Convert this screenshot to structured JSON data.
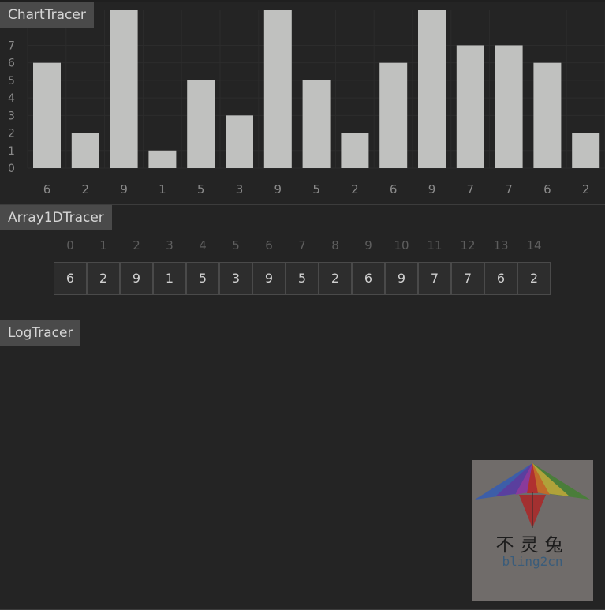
{
  "chart_panel": {
    "title": "ChartTracer"
  },
  "array_panel": {
    "title": "Array1DTracer"
  },
  "log_panel": {
    "title": "LogTracer"
  },
  "watermark": {
    "cn": "不灵兔",
    "en": "bling2cn"
  },
  "colors": {
    "bar": "#c0c1bf",
    "panel_bg": "#242424",
    "title_bg": "#4a4a4a",
    "grid": "#2c2c2c"
  },
  "chart_data": {
    "type": "bar",
    "categories": [
      "6",
      "2",
      "9",
      "1",
      "5",
      "3",
      "9",
      "5",
      "2",
      "6",
      "9",
      "7",
      "7",
      "6",
      "2"
    ],
    "values": [
      6,
      2,
      9,
      1,
      5,
      3,
      9,
      5,
      2,
      6,
      9,
      7,
      7,
      6,
      2
    ],
    "yticks": [
      "0",
      "1",
      "2",
      "3",
      "4",
      "5",
      "6",
      "7"
    ],
    "ylim": [
      0,
      9
    ],
    "grid": true
  },
  "array": {
    "indices": [
      "0",
      "1",
      "2",
      "3",
      "4",
      "5",
      "6",
      "7",
      "8",
      "9",
      "10",
      "11",
      "12",
      "13",
      "14"
    ],
    "values": [
      "6",
      "2",
      "9",
      "1",
      "5",
      "3",
      "9",
      "5",
      "2",
      "6",
      "9",
      "7",
      "7",
      "6",
      "2"
    ]
  }
}
